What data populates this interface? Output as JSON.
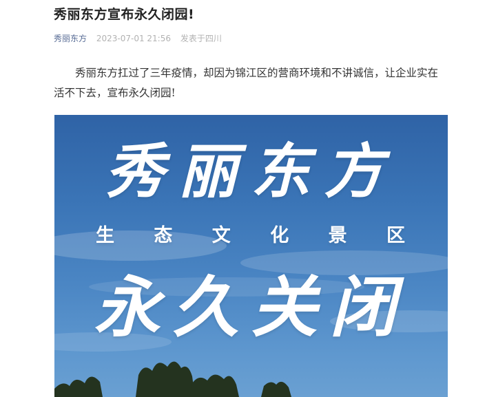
{
  "article": {
    "title": "秀丽东方宣布永久闭园!",
    "account_name": "秀丽东方",
    "publish_time": "2023-07-01 21:56",
    "location": "发表于四川",
    "paragraph": "秀丽东方扛过了三年疫情，却因为锦江区的营商环境和不讲诚信，让企业实在活不下去，宣布永久闭园!"
  },
  "hero_image": {
    "brand_text": "秀丽东方",
    "subtitle_text": "生 态 文 化 景 区",
    "announcement_text": "永久关闭",
    "sky_color": "#3a74b6",
    "text_color": "#ffffff"
  }
}
